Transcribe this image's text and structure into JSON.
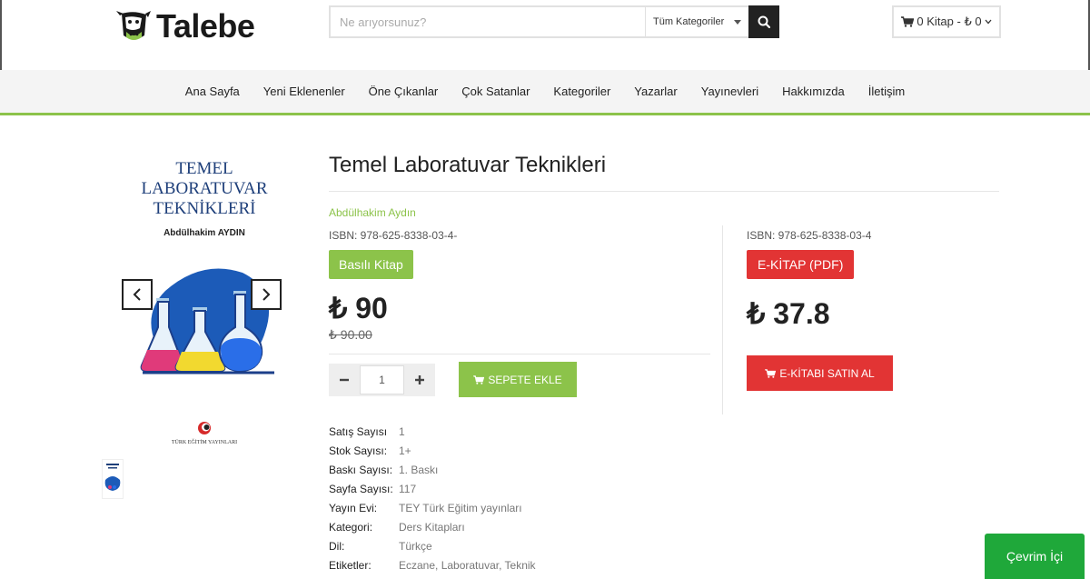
{
  "brand": {
    "name": "Talebe"
  },
  "search": {
    "placeholder": "Ne arıyorsunuz?",
    "category_selected": "Tüm Kategoriler"
  },
  "cart": {
    "summary": "0 Kitap - ₺ 0"
  },
  "nav": {
    "items": [
      "Ana Sayfa",
      "Yeni Eklenenler",
      "Öne Çıkanlar",
      "Çok Satanlar",
      "Kategoriler",
      "Yazarlar",
      "Yayınevleri",
      "Hakkımızda",
      "İletişim"
    ]
  },
  "cover": {
    "title_lines": [
      "TEMEL",
      "LABORATUVAR",
      "TEKNİKLERİ"
    ],
    "author": "Abdülhakim AYDIN",
    "publisher_text": "TÜRK EĞİTİM YAYINLARI"
  },
  "product": {
    "title": "Temel Laboratuvar Teknikleri",
    "author": "Abdülhakim Aydın",
    "print": {
      "isbn": "ISBN: 978-625-8338-03-4-",
      "badge": "Basılı Kitap",
      "price": "₺ 90",
      "old_price": "₺ 90.00",
      "quantity": "1",
      "add_to_cart": "SEPETE EKLE"
    },
    "ebook": {
      "isbn": "ISBN: 978-625-8338-03-4",
      "badge": "E-KİTAP (PDF)",
      "price": "₺ 37.8",
      "buy": "E-KİTABI SATIN AL"
    },
    "details": [
      {
        "label": "Satış Sayısı",
        "value": "1"
      },
      {
        "label": "Stok Sayısı:",
        "value": "1+"
      },
      {
        "label": "Baskı Sayısı:",
        "value": "1. Baskı"
      },
      {
        "label": "Sayfa Sayısı:",
        "value": "117"
      },
      {
        "label": "Yayın Evi:",
        "value": "TEY Türk Eğitim yayınları"
      },
      {
        "label": "Kategori:",
        "value": "Ders Kitapları"
      },
      {
        "label": "Dil:",
        "value": "Türkçe"
      },
      {
        "label": "Etiketler:",
        "value": "Eczane, Laboratuvar, Teknik"
      }
    ]
  },
  "chat": {
    "label": "Çevrim İçi"
  },
  "colors": {
    "accent_green": "#8cc34a",
    "accent_red": "#e23434",
    "chat_green": "#1fa83a",
    "cover_blue": "#1e3f7a"
  }
}
